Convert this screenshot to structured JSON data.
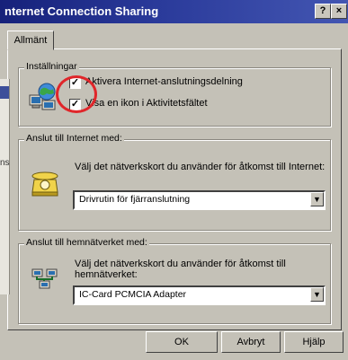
{
  "window": {
    "title": "nternet Connection Sharing",
    "help_btn": "?",
    "close_btn": "×"
  },
  "tabs": [
    {
      "label": "Allmänt"
    }
  ],
  "settings": {
    "legend": "Inställningar",
    "enable_sharing": {
      "label": "Aktivera Internet-anslutningsdelning",
      "checked": true
    },
    "show_icon": {
      "label": "Visa en ikon i Aktivitetsfältet",
      "checked": true
    }
  },
  "internet": {
    "legend": "Anslut till Internet med:",
    "instruction": "Välj det nätverkskort du använder för åtkomst till Internet:",
    "selected": "Drivrutin för fjärranslutning"
  },
  "home_network": {
    "legend": "Anslut till hemnätverket med:",
    "instruction_line1": "Välj det nätverkskort du använder för åtkomst till",
    "instruction_line2": "hemnätverket:",
    "selected": "IC-Card PCMCIA Adapter"
  },
  "buttons": {
    "ok": "OK",
    "cancel": "Avbryt",
    "help": "Hjälp"
  },
  "background_fragment": "ns"
}
